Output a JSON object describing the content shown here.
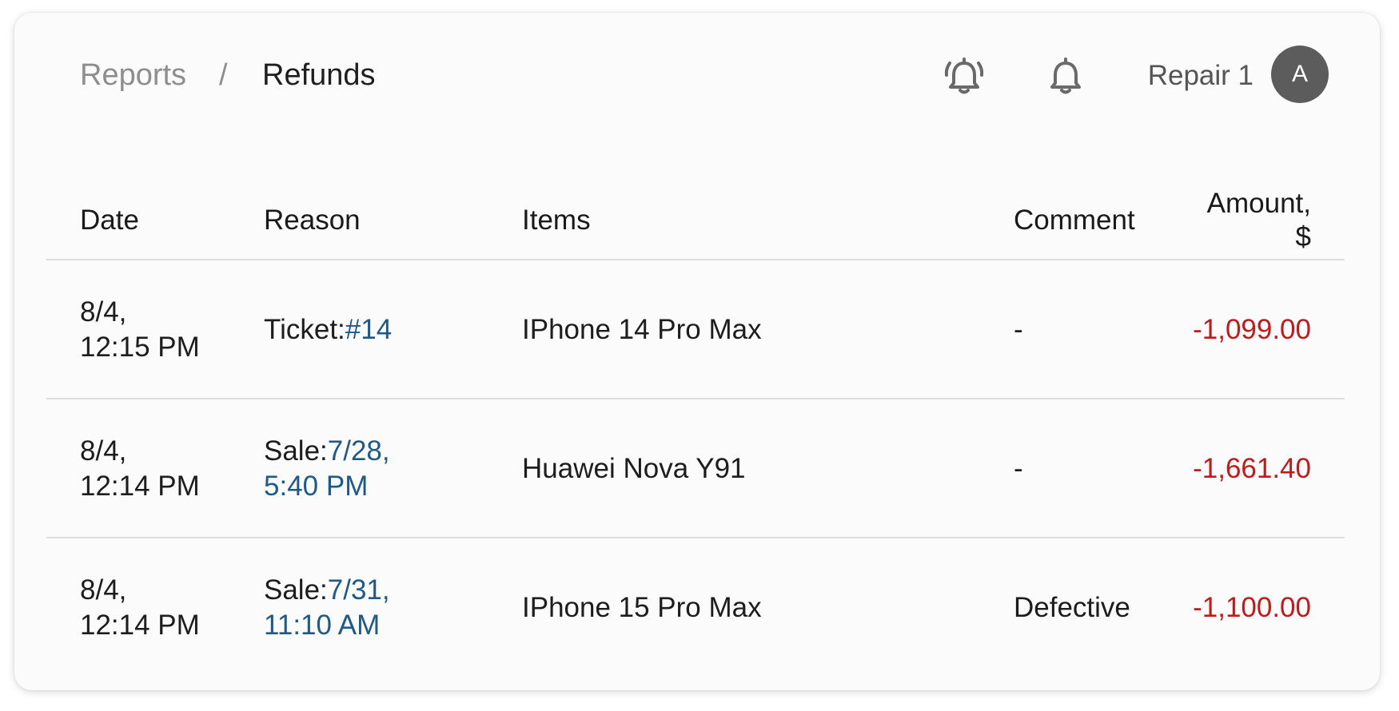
{
  "breadcrumb": {
    "parent": "Reports",
    "separator": "/",
    "current": "Refunds"
  },
  "header": {
    "icons": [
      "bell-ringing-icon",
      "bell-icon"
    ],
    "user_name": "Repair 1",
    "avatar_initial": "A"
  },
  "table": {
    "columns": {
      "date": "Date",
      "reason": "Reason",
      "items": "Items",
      "comment": "Comment",
      "amount_line1": "Amount,",
      "amount_line2": "$"
    },
    "rows": [
      {
        "date_line1": "8/4,",
        "date_line2": "12:15 PM",
        "reason_type": "Ticket:",
        "reason_link": "#14",
        "items": "IPhone 14 Pro Max",
        "comment": "-",
        "amount": "-1,099.00"
      },
      {
        "date_line1": "8/4,",
        "date_line2": "12:14 PM",
        "reason_type": "Sale:",
        "reason_link": "7/28, 5:40 PM",
        "items": "Huawei Nova Y91",
        "comment": "-",
        "amount": "-1,661.40"
      },
      {
        "date_line1": "8/4,",
        "date_line2": "12:14 PM",
        "reason_type": "Sale:",
        "reason_link": "7/31, 11:10 AM",
        "items": "IPhone 15 Pro Max",
        "comment": "Defective",
        "amount": "-1,100.00"
      }
    ]
  },
  "colors": {
    "link": "#1d5a8c",
    "negative_amount": "#c21a1a",
    "avatar_bg": "#5c5c5c"
  }
}
